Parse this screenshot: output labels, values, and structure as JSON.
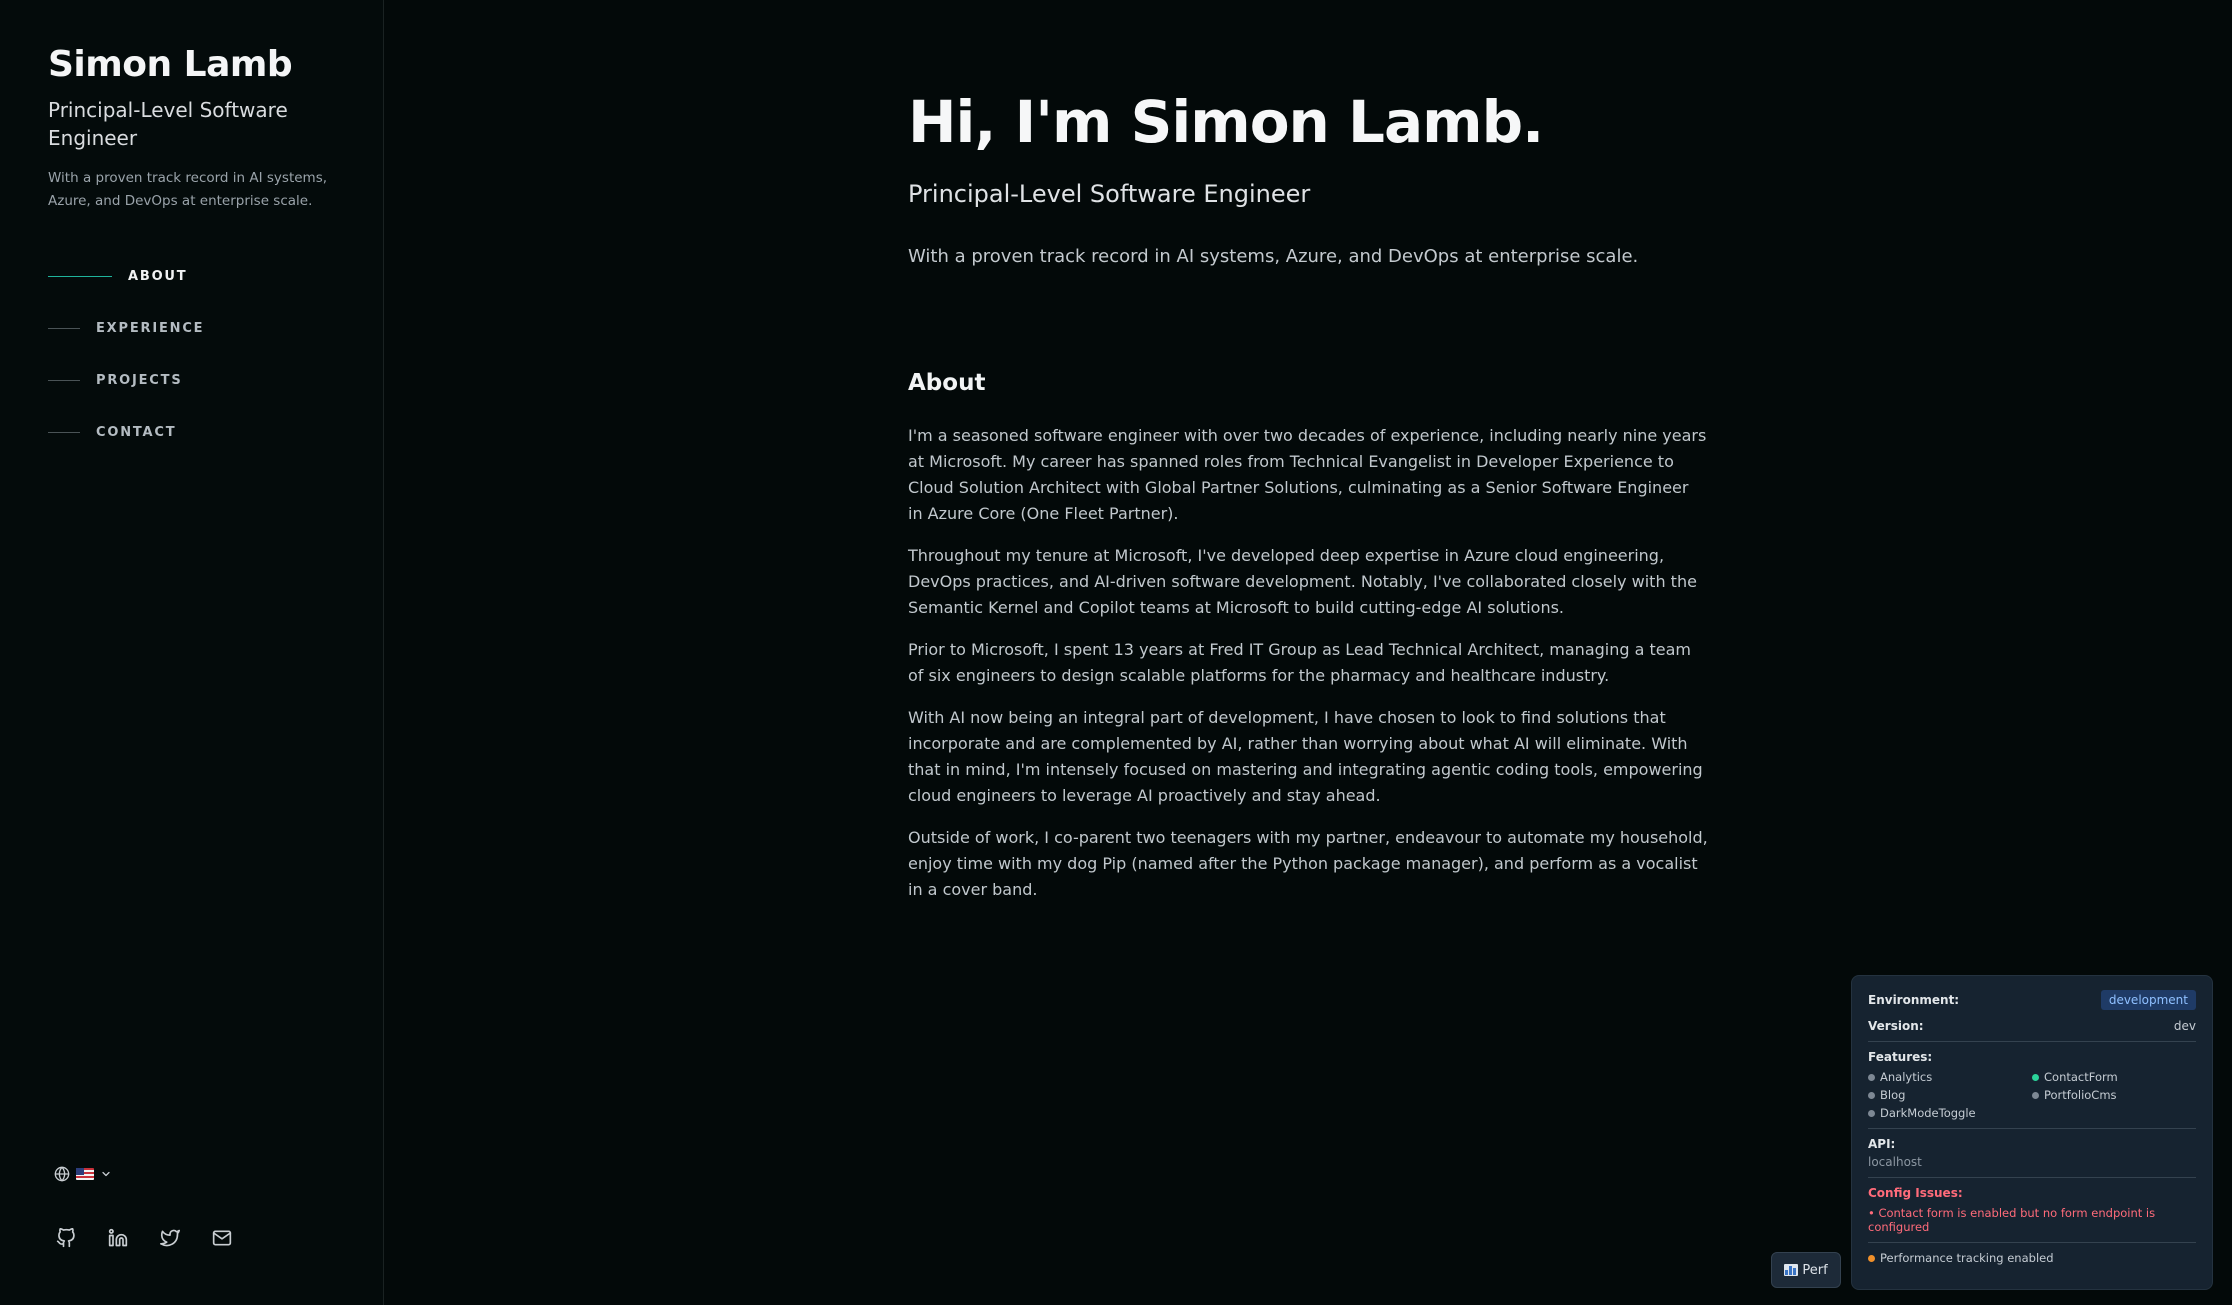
{
  "sidebar": {
    "name": "Simon Lamb",
    "role": "Principal-Level Software Engineer",
    "tagline": "With a proven track record in AI systems, Azure, and DevOps at enterprise scale.",
    "nav": [
      {
        "label": "ABOUT",
        "active": true
      },
      {
        "label": "EXPERIENCE",
        "active": false
      },
      {
        "label": "PROJECTS",
        "active": false
      },
      {
        "label": "CONTACT",
        "active": false
      }
    ],
    "language": {
      "icon": "globe-icon",
      "flag": "us-flag",
      "chevron": "chevron-down-icon"
    },
    "socials": [
      "github-icon",
      "linkedin-icon",
      "twitter-icon",
      "mail-icon"
    ]
  },
  "hero": {
    "title": "Hi, I'm Simon Lamb.",
    "role": "Principal-Level Software Engineer",
    "tagline": "With a proven track record in AI systems, Azure, and DevOps at enterprise scale."
  },
  "about": {
    "heading": "About",
    "paragraphs": [
      "I'm a seasoned software engineer with over two decades of experience, including nearly nine years at Microsoft. My career has spanned roles from Technical Evangelist in Developer Experience to Cloud Solution Architect with Global Partner Solutions, culminating as a Senior Software Engineer in Azure Core (One Fleet Partner).",
      "Throughout my tenure at Microsoft, I've developed deep expertise in Azure cloud engineering, DevOps practices, and AI-driven software development. Notably, I've collaborated closely with the Semantic Kernel and Copilot teams at Microsoft to build cutting-edge AI solutions.",
      "Prior to Microsoft, I spent 13 years at Fred IT Group as Lead Technical Architect, managing a team of six engineers to design scalable platforms for the pharmacy and healthcare industry.",
      "With AI now being an integral part of development, I have chosen to look to find solutions that incorporate and are complemented by AI, rather than worrying about what AI will eliminate. With that in mind, I'm intensely focused on mastering and integrating agentic coding tools, empowering cloud engineers to leverage AI proactively and stay ahead.",
      "Outside of work, I co-parent two teenagers with my partner, endeavour to automate my household, enjoy time with my dog Pip (named after the Python package manager), and perform as a vocalist in a cover band."
    ]
  },
  "config_panel": {
    "environment_label": "Environment:",
    "environment_value": "development",
    "version_label": "Version:",
    "version_value": "dev",
    "features_label": "Features:",
    "features": [
      {
        "name": "Analytics",
        "enabled": false
      },
      {
        "name": "ContactForm",
        "enabled": true
      },
      {
        "name": "Blog",
        "enabled": false
      },
      {
        "name": "PortfolioCms",
        "enabled": false
      },
      {
        "name": "DarkModeToggle",
        "enabled": false
      }
    ],
    "api_label": "API:",
    "api_value": "localhost",
    "issues_label": "Config Issues:",
    "issues": [
      "• Contact form is enabled but no form endpoint is configured"
    ],
    "perf_status": "Performance tracking enabled"
  },
  "perf_button": {
    "label": "Perf",
    "icon": "bar-chart-icon"
  },
  "colors": {
    "background": "#030909",
    "accent": "#1fb39b",
    "panel": "#162330",
    "error": "#ff6b7a",
    "enabled": "#2bd39a",
    "perf": "#f0902a"
  }
}
